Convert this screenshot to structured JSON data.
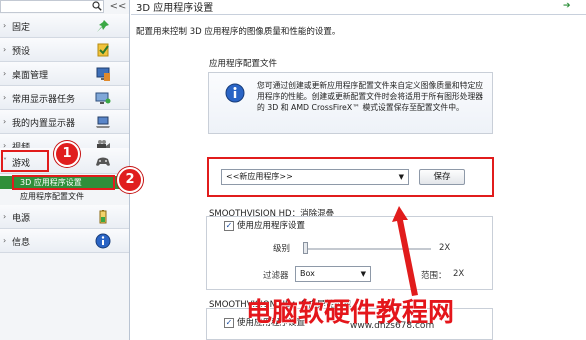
{
  "sidebar": {
    "collapse_label": "<<",
    "items": [
      {
        "label": "固定",
        "icon": "pin-icon"
      },
      {
        "label": "预设",
        "icon": "preset-icon"
      },
      {
        "label": "桌面管理",
        "icon": "desktop-icon"
      },
      {
        "label": "常用显示器任务",
        "icon": "monitor-icon"
      },
      {
        "label": "我的内置显示器",
        "icon": "laptop-icon"
      },
      {
        "label": "视频",
        "icon": "video-icon"
      },
      {
        "label": "游戏",
        "icon": "gamepad-icon"
      },
      {
        "label": "电源",
        "icon": "battery-icon"
      },
      {
        "label": "信息",
        "icon": "info-icon"
      }
    ],
    "sub_items": [
      "3D 应用程序设置",
      "应用程序配置文件"
    ]
  },
  "annotations": {
    "badge1": "1",
    "badge2": "2"
  },
  "main": {
    "title": "3D 应用程序设置",
    "description": "配置用来控制 3D 应用程序的图像质量和性能的设置。",
    "profile_group_title": "应用程序配置文件",
    "info_text": "您可通过创建或更新应用程序配置文件来自定义图像质量和特定应用程序的性能。创建或更新配置文件时会将适用于所有图形处理器的 3D 和 AMD CrossFireX™ 模式设置保存至配置文件中。",
    "profile_select_value": "<<新应用程序>>",
    "save_button": "保存",
    "smooth_aa_title": "SMOOTHVISION HD：消除混叠",
    "use_app_settings_1": "使用应用程序设置",
    "level_label": "级别",
    "level_value": "2X",
    "filter_label": "过滤器",
    "filter_value": "Box",
    "range_label": "范围：",
    "range_value": "2X",
    "smooth_af_title": "SMOOTHVISION HD：各向异性过滤",
    "use_app_settings_2": "使用应用程序设置"
  },
  "watermark": {
    "cn": "电脑软硬件教程网",
    "url": "www.dnzs678.com"
  },
  "colors": {
    "accent_red": "#e11c1c",
    "selected_green": "#2f8f3a"
  }
}
